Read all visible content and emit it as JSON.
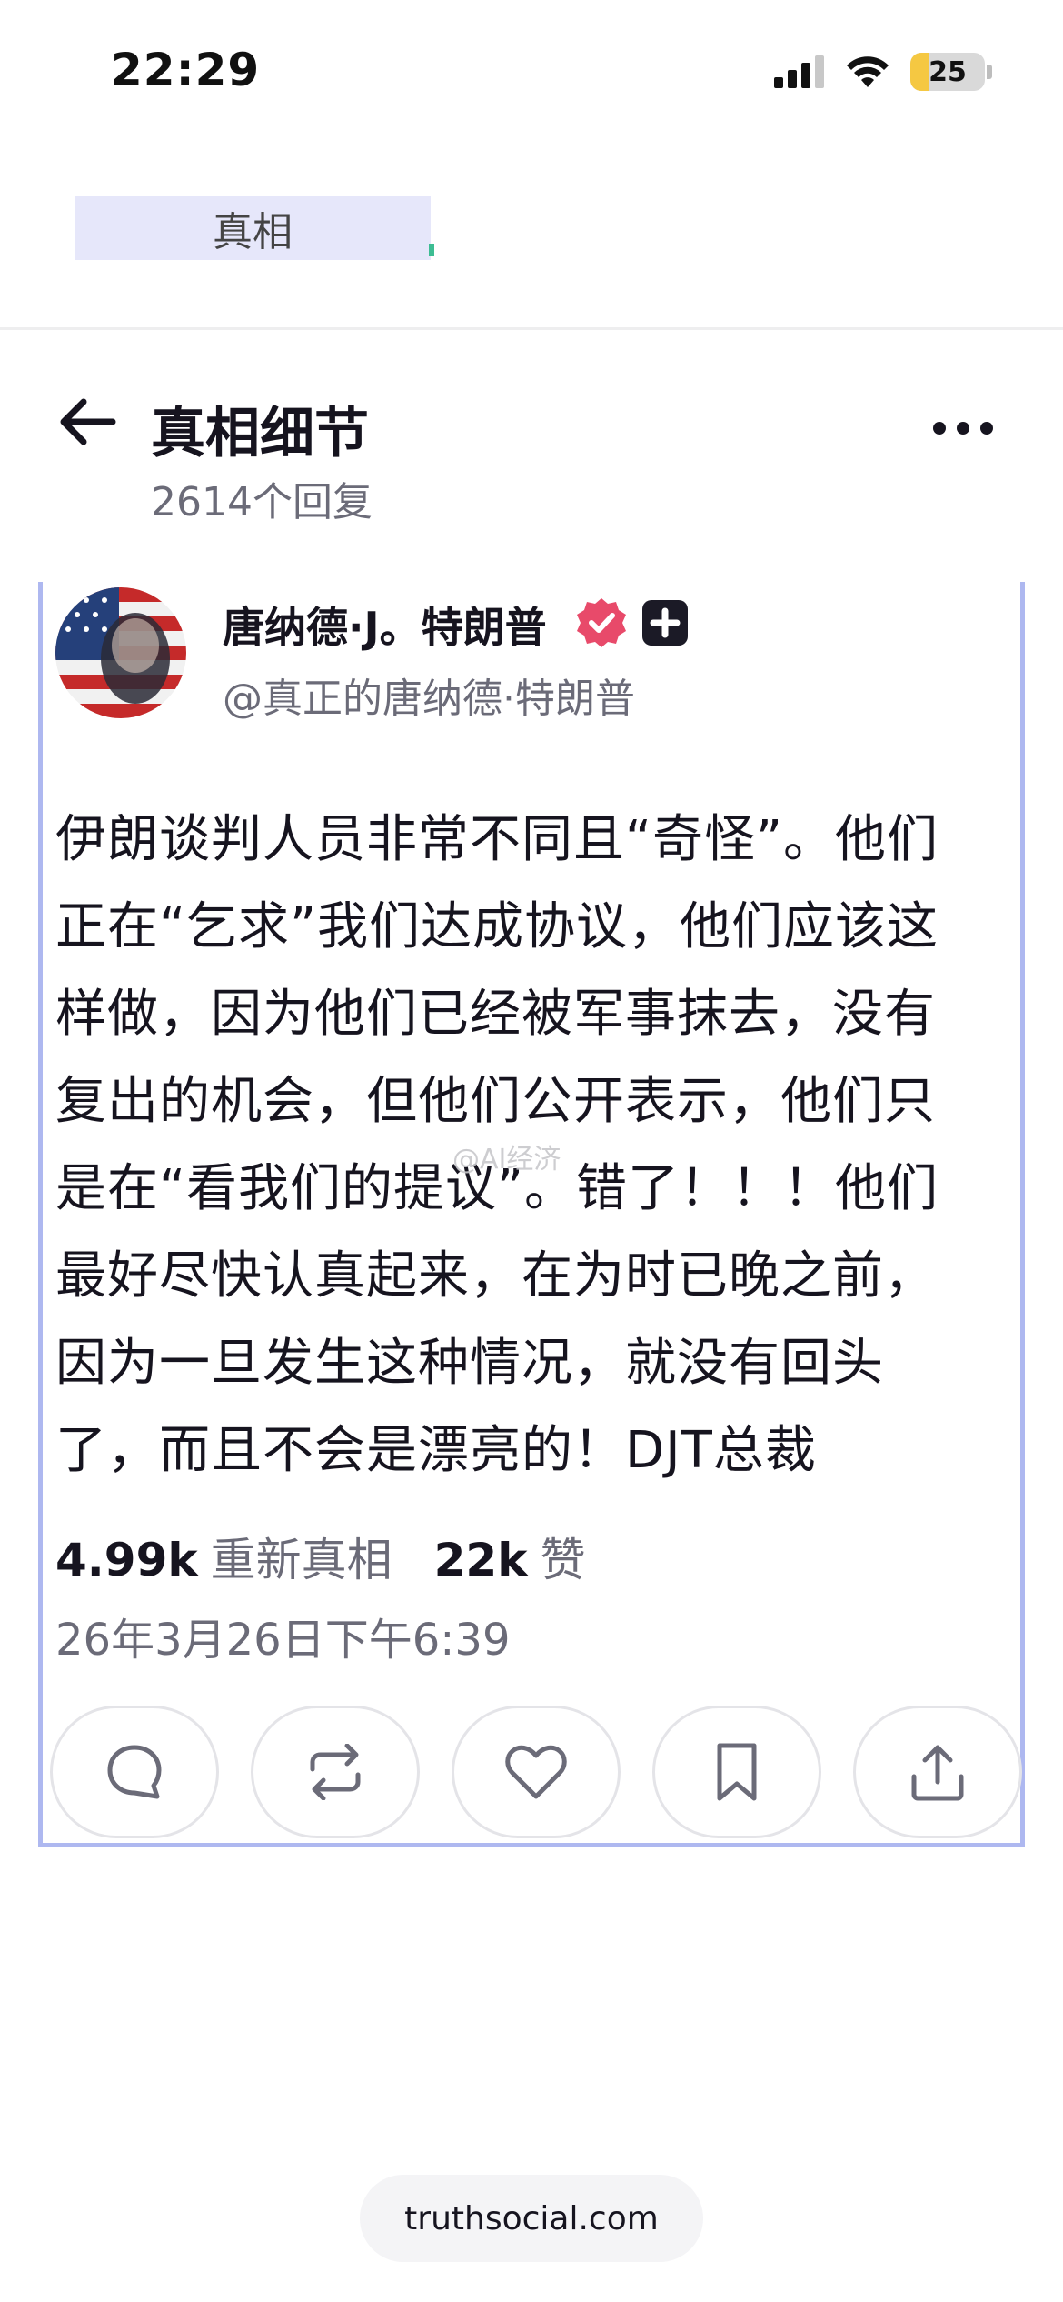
{
  "status_bar": {
    "time": "22:29",
    "battery": "25",
    "battery_level": 0.25,
    "icons": [
      "cellular-signal-icon",
      "wifi-icon",
      "battery-icon"
    ]
  },
  "top_tab": {
    "label": "真相"
  },
  "header": {
    "title": "真相细节",
    "reply_count": "2614个回复"
  },
  "post": {
    "author_name": "唐纳德·J。特朗普",
    "author_handle": "@真正的唐纳德·特朗普",
    "body_lines": [
      "伊朗谈判人员非常不同且“奇怪”。他们",
      "正在“乞求”我们达成协议，他们应该这",
      "样做，因为他们已经被军事抹去，没有",
      "复出的机会，但他们公开表示，他们只",
      "是在“看我们的提议”。错了！！！他们",
      "最好尽快认真起来，在为时已晚之前，",
      "因为一旦发生这种情况，就没有回头",
      "了，而且不会是漂亮的！DJT总裁"
    ],
    "retruths_count": "4.99k",
    "retruths_label": "重新真相",
    "likes_count": "22k",
    "likes_label": "赞",
    "timestamp": "26年3月26日下午6:39"
  },
  "watermark": "@AI经济",
  "footer": {
    "domain": "truthsocial.com"
  },
  "colors": {
    "card_border": "#aeb8f0",
    "verified_badge": "#e84a6a",
    "tab_chip": "#e6e7fa",
    "text_primary": "#16141f",
    "text_secondary": "#6b6b78"
  }
}
